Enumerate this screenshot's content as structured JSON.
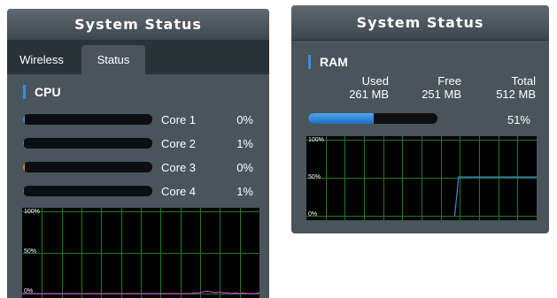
{
  "left_panel": {
    "title": "System Status",
    "tabs": [
      {
        "label": "Wireless",
        "active": false
      },
      {
        "label": "Status",
        "active": true
      }
    ],
    "cpu": {
      "title": "CPU",
      "cores": [
        {
          "label": "Core 1",
          "percent_text": "0%",
          "value": 0,
          "color": "#3b8fdc"
        },
        {
          "label": "Core 2",
          "percent_text": "1%",
          "value": 1,
          "color": "#3b8fdc"
        },
        {
          "label": "Core 3",
          "percent_text": "0%",
          "value": 0,
          "color": "#e08020"
        },
        {
          "label": "Core 4",
          "percent_text": "1%",
          "value": 1,
          "color": "#c040c0"
        }
      ],
      "graph": {
        "labels": [
          "100%",
          "50%",
          "0%"
        ],
        "grid_color": "#1f7a1f"
      }
    }
  },
  "right_panel": {
    "title": "System Status",
    "ram": {
      "title": "RAM",
      "headers": [
        "Used",
        "Free",
        "Total"
      ],
      "values": [
        "261 MB",
        "251 MB",
        "512 MB"
      ],
      "usage_text": "51%",
      "usage_value": 51,
      "bar_color": "#3b8fdc",
      "graph": {
        "labels": [
          "100%",
          "50%",
          "0%"
        ],
        "grid_color": "#1f7a1f",
        "line_color": "#3b8fdc"
      }
    }
  },
  "chart_data": [
    {
      "type": "line",
      "title": "",
      "xlabel": "",
      "ylabel": "",
      "ylim": [
        0,
        100
      ],
      "ytick_labels": [
        "100%",
        "50%",
        "0%"
      ],
      "grid": true,
      "series": [
        {
          "values": [
            0,
            0,
            0,
            0,
            0,
            0,
            0,
            0,
            0,
            0,
            0,
            0,
            0,
            0,
            0,
            0,
            0,
            0,
            0,
            0,
            0,
            0,
            0,
            0,
            0,
            0,
            0,
            0,
            0,
            0,
            0,
            0,
            0,
            0,
            0,
            0,
            0,
            0,
            0,
            0,
            0,
            0,
            0,
            1,
            1,
            2,
            3,
            2,
            1,
            2,
            1,
            1,
            0,
            1,
            0,
            1,
            0,
            0,
            0,
            1
          ]
        }
      ]
    },
    {
      "type": "line",
      "title": "",
      "xlabel": "",
      "ylabel": "",
      "ylim": [
        0,
        100
      ],
      "ytick_labels": [
        "100%",
        "50%",
        "0%"
      ],
      "grid": true,
      "series": [
        {
          "values": [
            null,
            null,
            null,
            null,
            null,
            null,
            null,
            null,
            null,
            null,
            null,
            null,
            null,
            null,
            null,
            null,
            null,
            null,
            null,
            null,
            null,
            null,
            null,
            null,
            null,
            null,
            null,
            null,
            null,
            null,
            null,
            null,
            null,
            null,
            null,
            null,
            null,
            null,
            0,
            51,
            51,
            51,
            51,
            51,
            51,
            51,
            51,
            51,
            51,
            51,
            51,
            51,
            51,
            51,
            51,
            51,
            51,
            51,
            51,
            51
          ]
        }
      ]
    }
  ]
}
